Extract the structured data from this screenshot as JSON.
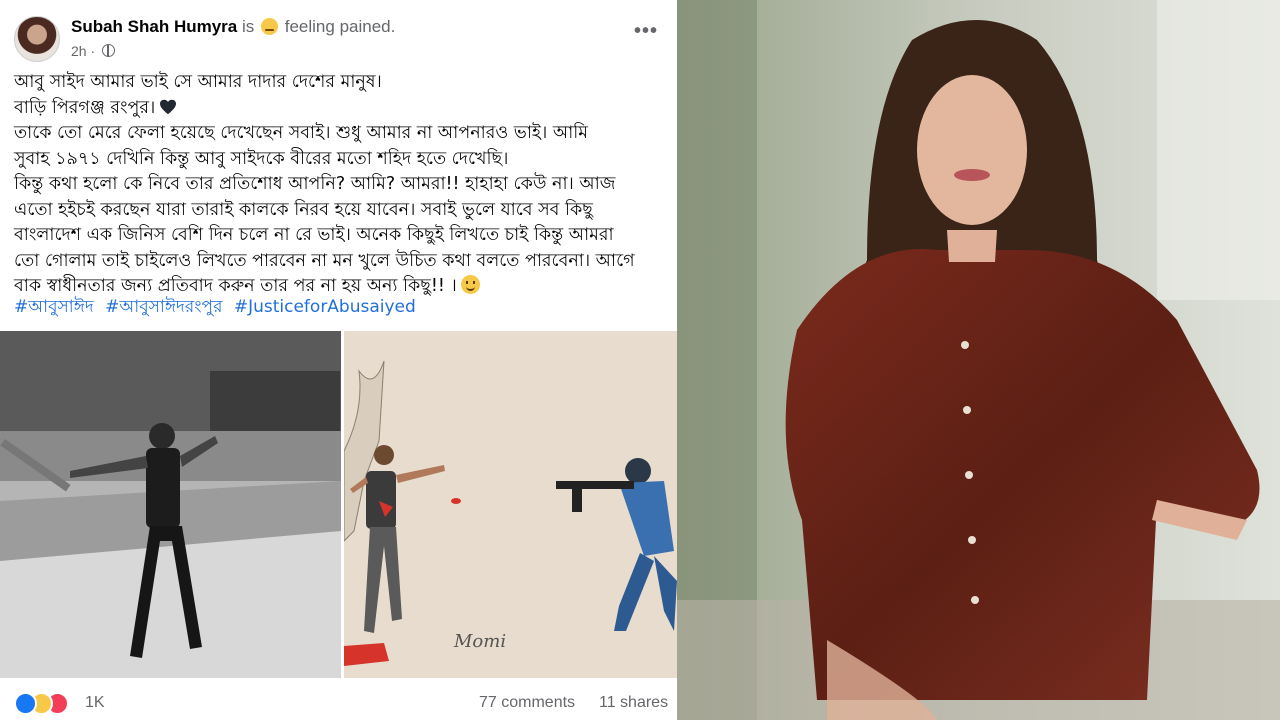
{
  "post": {
    "author": "Subah Shah Humyra",
    "is_word": "is",
    "feeling_text": "feeling pained.",
    "time": "2h",
    "more_label": "•••",
    "lines": [
      "আবু সাইদ আমার ভাই সে আমার দাদার দেশের মানুষ।",
      "বাড়ি পিরগঞ্জ রংপুর।",
      "তাকে তো মেরে ফেলা হয়েছে দেখেছেন সবাই।  শুধু আমার না আপনারও ভাই। আমি",
      "সুবাহ ১৯৭১ দেখিনি কিন্তু আবু সাইদকে বীরের মতো শহিদ হতে দেখেছি।",
      " কিন্তু কথা হলো কে নিবে তার প্রতিশোধ আপনি?  আমি? আমরা!!  হাহাহা কেউ না। আজ",
      "এতো হইচই করছেন যারা তারাই কালকে নিরব হয়ে যাবেন।  সবাই ভুলে যাবে সব কিছু",
      "বাংলাদেশ এক জিনিস বেশি দিন চলে না রে ভাই। অনেক কিছুই লিখতে চাই কিন্তু আমরা",
      "তো গোলাম তাই চাইলেও লিখতে পারবেন না মন খুলে উচিত কথা বলতে পারবেনা।  আগে",
      "বাক স্বাধীনতার জন্য প্রতিবাদ করুন তার পর না হয় অন্য কিছু!! ।"
    ],
    "hashtags": [
      "#আবুসাঈদ",
      "#আবুসাঈদরংপুর",
      "#JusticeforAbusaiyed"
    ],
    "artist_signature": "Momi"
  },
  "footer": {
    "reaction_count": "1K",
    "comments": "77 comments",
    "shares": "11 shares"
  },
  "icons": {
    "feeling": "pained-face-icon",
    "privacy": "globe-icon",
    "heart": "black-heart-icon",
    "smile": "smile-icon",
    "reactions": [
      "like-icon",
      "sad-icon",
      "love-icon"
    ]
  },
  "colors": {
    "link": "#216fdb",
    "secondary_text": "#65676b",
    "shirt": "#6b2418"
  }
}
